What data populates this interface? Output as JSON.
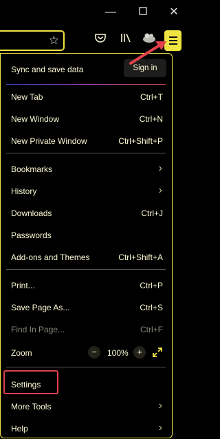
{
  "window": {
    "minimize_glyph": "—",
    "maximize_glyph": "☐",
    "close_glyph": "✕"
  },
  "toolbar": {
    "bookmark_star_icon": "star-icon",
    "pocket_icon": "pocket-icon",
    "library_icon": "library-icon",
    "extension_icon": "extension-icon",
    "menu_icon": "hamburger-icon",
    "accent_color": "#f0e442"
  },
  "annotation": {
    "arrow_color": "#e0414b",
    "highlight_color": "#e0414b"
  },
  "sync": {
    "label": "Sync and save data",
    "signin_label": "Sign in"
  },
  "menu": {
    "new_tab": {
      "label": "New Tab",
      "shortcut": "Ctrl+T"
    },
    "new_window": {
      "label": "New Window",
      "shortcut": "Ctrl+N"
    },
    "new_private_window": {
      "label": "New Private Window",
      "shortcut": "Ctrl+Shift+P"
    },
    "bookmarks": {
      "label": "Bookmarks"
    },
    "history": {
      "label": "History"
    },
    "downloads": {
      "label": "Downloads",
      "shortcut": "Ctrl+J"
    },
    "passwords": {
      "label": "Passwords"
    },
    "addons": {
      "label": "Add-ons and Themes",
      "shortcut": "Ctrl+Shift+A"
    },
    "print": {
      "label": "Print...",
      "shortcut": "Ctrl+P"
    },
    "save_page": {
      "label": "Save Page As...",
      "shortcut": "Ctrl+S"
    },
    "find": {
      "label": "Find In Page...",
      "shortcut": "Ctrl+F"
    },
    "zoom": {
      "label": "Zoom",
      "minus": "−",
      "value": "100%",
      "plus": "+"
    },
    "settings": {
      "label": "Settings"
    },
    "more_tools": {
      "label": "More Tools"
    },
    "help": {
      "label": "Help"
    }
  }
}
